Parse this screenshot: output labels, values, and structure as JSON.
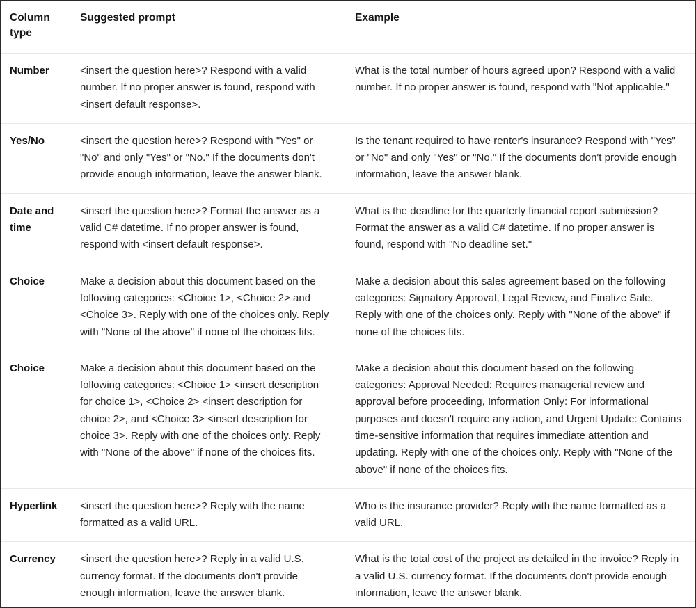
{
  "table": {
    "headers": {
      "column_type": "Column type",
      "suggested_prompt": "Suggested prompt",
      "example": "Example"
    },
    "rows": [
      {
        "column_type": "Number",
        "suggested_prompt": "<insert the question here>? Respond with a valid number. If no proper answer is found, respond with <insert default response>.",
        "example": "What is the total number of hours agreed upon? Respond with a valid number. If no proper answer is found, respond with \"Not applicable.\""
      },
      {
        "column_type": "Yes/No",
        "suggested_prompt": "<insert the question here>? Respond with \"Yes\" or \"No\" and only \"Yes\" or \"No.\" If the documents don't provide enough information, leave the answer blank.",
        "example": "Is the tenant required to have renter's insurance? Respond with \"Yes\" or \"No\" and only \"Yes\" or \"No.\" If the documents don't provide enough information, leave the answer blank."
      },
      {
        "column_type": "Date and time",
        "suggested_prompt": "<insert the question here>? Format the answer as a valid C# datetime. If no proper answer is found, respond with <insert default response>.",
        "example": "What is the deadline for the quarterly financial report submission? Format the answer as a valid C# datetime. If no proper answer is found, respond with \"No deadline set.\""
      },
      {
        "column_type": "Choice",
        "suggested_prompt": "Make a decision about this document based on the following categories: <Choice 1>, <Choice 2> and <Choice 3>. Reply with one of the choices only. Reply with \"None of the above\" if none of the choices fits.",
        "example": "Make a decision about this sales agreement based on the following categories: Signatory Approval, Legal Review, and Finalize Sale. Reply with one of the choices only. Reply with \"None of the above\" if none of the choices fits."
      },
      {
        "column_type": "Choice",
        "suggested_prompt": "Make a decision about this document based on the following categories: <Choice 1> <insert description for choice 1>, <Choice 2> <insert description for choice 2>, and <Choice 3> <insert description for choice 3>. Reply with one of the choices only. Reply with \"None of the above\" if none of the choices fits.",
        "example": "Make a decision about this document based on the following categories: Approval Needed: Requires managerial review and approval before proceeding, Information Only: For informational purposes and doesn't require any action, and Urgent Update: Contains time-sensitive information that requires immediate attention and updating. Reply with one of the choices only. Reply with \"None of the above\" if none of the choices fits."
      },
      {
        "column_type": "Hyperlink",
        "suggested_prompt": "<insert the question here>? Reply with the name formatted as a valid URL.",
        "example": "Who is the insurance provider? Reply with the name formatted as a valid URL."
      },
      {
        "column_type": "Currency",
        "suggested_prompt": "<insert the question here>? Reply in a valid U.S. currency format. If the documents don't provide enough information, leave the answer blank.",
        "example": "What is the total cost of the project as detailed in the invoice? Reply in a valid U.S. currency format. If the documents don't provide enough information, leave the answer blank."
      }
    ]
  },
  "colors": {
    "outer_border": "#2b2b2b",
    "row_divider": "#e8e8e8",
    "text": "#262626",
    "heading_text": "#161616",
    "background": "#ffffff"
  }
}
